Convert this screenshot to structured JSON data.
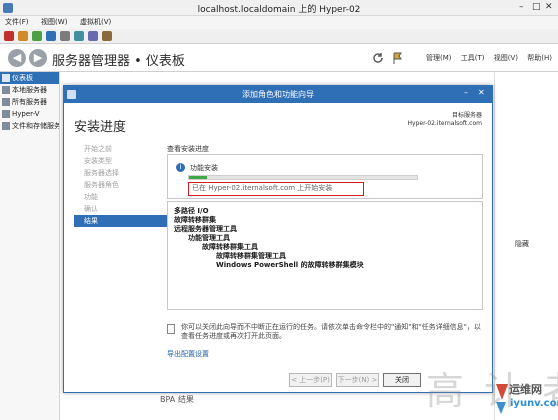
{
  "vm_window": {
    "title": "localhost.localdomain 上的 Hyper-02",
    "menu": [
      "文件(F)",
      "视图(W)",
      "虚拟机(V)"
    ]
  },
  "server_manager": {
    "breadcrumb": "服务器管理器 • 仪表板",
    "header_menu": [
      "管理(M)",
      "工具(T)",
      "视图(V)",
      "帮助(H)"
    ],
    "nav_items": [
      "仪表板",
      "本地服务器",
      "所有服务器",
      "Hyper-V",
      "文件和存储服务"
    ],
    "background_label": "隐藏",
    "bpa_label": "BPA 结果"
  },
  "wizard": {
    "title": "添加角色和功能向导",
    "heading": "安装进度",
    "target_label": "目标服务器",
    "target_server": "Hyper-02.iternalsoft.com",
    "steps": [
      "开始之前",
      "安装类型",
      "服务器选择",
      "服务器角色",
      "功能",
      "确认",
      "结果"
    ],
    "active_step_index": 6,
    "section_label": "查看安装进度",
    "status_title": "功能安装",
    "progress_fraction": 0.08,
    "install_message": "已在 Hyper-02.iternalsoft.com 上开始安装",
    "features": [
      {
        "label": "多路径 I/O",
        "level": 0
      },
      {
        "label": "故障转移群集",
        "level": 0
      },
      {
        "label": "远程服务器管理工具",
        "level": 0
      },
      {
        "label": "功能管理工具",
        "level": 1
      },
      {
        "label": "故障转移群集工具",
        "level": 2
      },
      {
        "label": "故障转移群集管理工具",
        "level": 3
      },
      {
        "label": "Windows PowerShell 的故障转移群集模块",
        "level": 3
      }
    ],
    "note": "你可以关闭此向导而不中断正在运行的任务。请依次单击命令栏中的\"通知\"和\"任务详细信息\"，以查看任务进度或再次打开此页面。",
    "export_link": "导出配置设置",
    "buttons": {
      "prev": "< 上一步(P)",
      "next": "下一步(N) >",
      "close": "关闭"
    }
  },
  "watermark": {
    "glyphs": "高 计 者",
    "site_cn": "运维网",
    "site_url": "iyunv.com"
  },
  "colors": {
    "accent": "#2f6fb6",
    "highlight_border": "#d11e1e",
    "progress": "#3fa845"
  }
}
